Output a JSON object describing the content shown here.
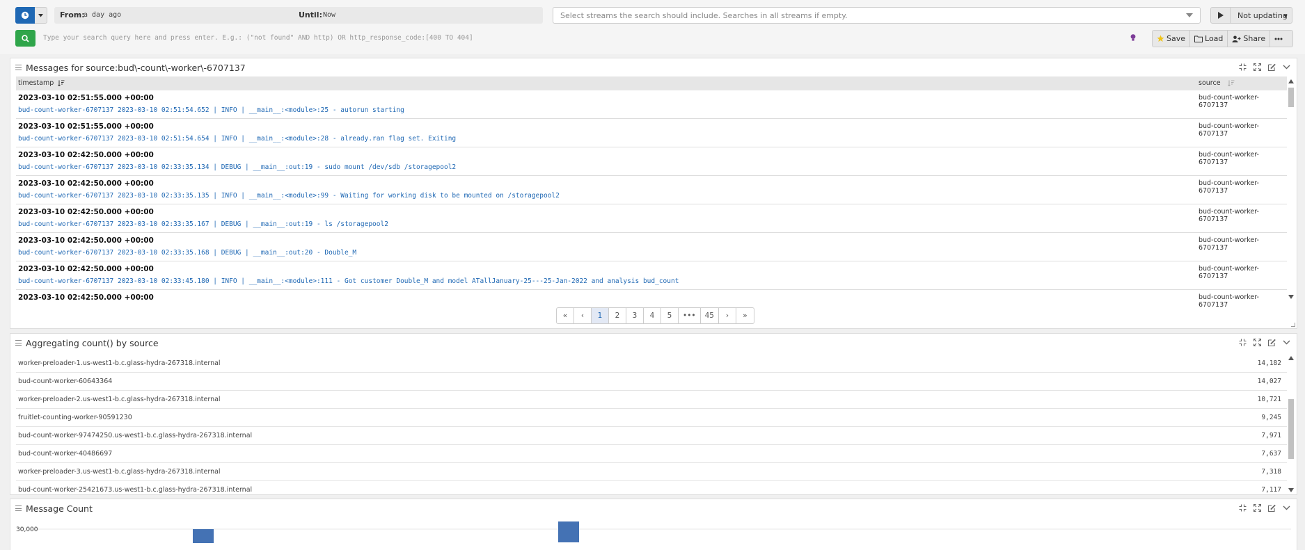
{
  "search": {
    "from_label": "From:",
    "from_value": "a day ago",
    "until_label": "Until:",
    "until_value": "Now",
    "streams_placeholder": "Select streams the search should include. Searches in all streams if empty.",
    "updating_label": "Not updating",
    "query_placeholder": "Type your search query here and press enter. E.g.: (\"not found\" AND http) OR http_response_code:[400 TO 404]",
    "save_label": "Save",
    "load_label": "Load",
    "share_label": "Share"
  },
  "colors": {
    "primary": "#1f68b4",
    "success": "#2fa54a",
    "bar": "#4472b4"
  },
  "messages_panel": {
    "title": "Messages for source:bud\\-count\\-worker\\-6707137",
    "col_timestamp": "timestamp",
    "col_source": "source",
    "rows": [
      {
        "timestamp": "2023-03-10 02:51:55.000 +00:00",
        "message": "bud-count-worker-6707137 2023-03-10 02:51:54.652 | INFO | __main__:<module>:25 - autorun starting",
        "source": "bud-count-worker-6707137"
      },
      {
        "timestamp": "2023-03-10 02:51:55.000 +00:00",
        "message": "bud-count-worker-6707137 2023-03-10 02:51:54.654 | INFO | __main__:<module>:28 - already.ran flag set. Exiting",
        "source": "bud-count-worker-6707137"
      },
      {
        "timestamp": "2023-03-10 02:42:50.000 +00:00",
        "message": "bud-count-worker-6707137 2023-03-10 02:33:35.134 | DEBUG | __main__:out:19 - sudo mount /dev/sdb /storagepool2",
        "source": "bud-count-worker-6707137"
      },
      {
        "timestamp": "2023-03-10 02:42:50.000 +00:00",
        "message": "bud-count-worker-6707137 2023-03-10 02:33:35.135 | INFO | __main__:<module>:99 - Waiting for working disk to be mounted on /storagepool2",
        "source": "bud-count-worker-6707137"
      },
      {
        "timestamp": "2023-03-10 02:42:50.000 +00:00",
        "message": "bud-count-worker-6707137 2023-03-10 02:33:35.167 | DEBUG | __main__:out:19 - ls /storagepool2",
        "source": "bud-count-worker-6707137"
      },
      {
        "timestamp": "2023-03-10 02:42:50.000 +00:00",
        "message": "bud-count-worker-6707137 2023-03-10 02:33:35.168 | DEBUG | __main__:out:20 - Double_M",
        "source": "bud-count-worker-6707137"
      },
      {
        "timestamp": "2023-03-10 02:42:50.000 +00:00",
        "message": "bud-count-worker-6707137 2023-03-10 02:33:45.180 | INFO | __main__:<module>:111 - Got customer Double_M and model ATallJanuary-25---25-Jan-2022 and analysis bud_count",
        "source": "bud-count-worker-6707137"
      },
      {
        "timestamp": "2023-03-10 02:42:50.000 +00:00",
        "message": "",
        "source": "bud-count-worker-6707137"
      }
    ],
    "pagination": [
      "«",
      "‹",
      "1",
      "2",
      "3",
      "4",
      "5",
      "•••",
      "45",
      "›",
      "»"
    ],
    "current_page": "1"
  },
  "aggregate_panel": {
    "title": "Aggregating count() by source",
    "rows": [
      {
        "key": "worker-preloader-1.us-west1-b.c.glass-hydra-267318.internal",
        "value": "14,182"
      },
      {
        "key": "bud-count-worker-60643364",
        "value": "14,027"
      },
      {
        "key": "worker-preloader-2.us-west1-b.c.glass-hydra-267318.internal",
        "value": "10,721"
      },
      {
        "key": "fruitlet-counting-worker-90591230",
        "value": "9,245"
      },
      {
        "key": "bud-count-worker-97474250.us-west1-b.c.glass-hydra-267318.internal",
        "value": "7,971"
      },
      {
        "key": "bud-count-worker-40486697",
        "value": "7,637"
      },
      {
        "key": "worker-preloader-3.us-west1-b.c.glass-hydra-267318.internal",
        "value": "7,318"
      },
      {
        "key": "bud-count-worker-25421673.us-west1-b.c.glass-hydra-267318.internal",
        "value": "7,117"
      }
    ]
  },
  "count_panel": {
    "title": "Message Count",
    "chart_data": {
      "type": "bar",
      "ytick_labels": [
        "30,000"
      ]
    }
  }
}
